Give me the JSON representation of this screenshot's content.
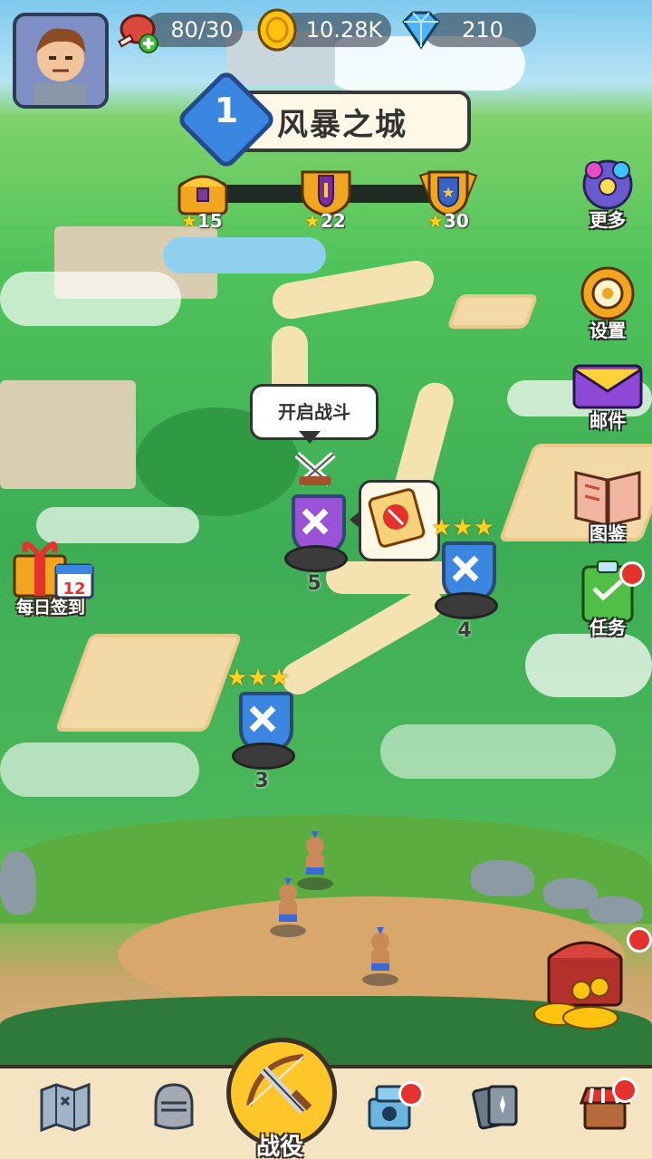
{
  "hud": {
    "energy": "80/30",
    "gold": "10.28K",
    "gems": "210"
  },
  "level": {
    "number": "1",
    "name": "风暴之城"
  },
  "progress_rewards": [
    {
      "stars": "15"
    },
    {
      "stars": "22"
    },
    {
      "stars": "30"
    }
  ],
  "side_menu": {
    "more": "更多",
    "settings": "设置",
    "mail": "邮件",
    "codex": "图鉴",
    "tasks": "任务"
  },
  "daily_signin": "每日签到",
  "calendar_day": "12",
  "stages": {
    "bubble": "开启战斗",
    "s3": "3",
    "s4": "4",
    "s5": "5"
  },
  "nav": {
    "battle": "战役"
  },
  "colors": {
    "accent_gold": "#ffc62a",
    "badge_red": "#e5322d",
    "stage_blue": "#3b86e0",
    "stage_purple": "#9a52d6"
  }
}
